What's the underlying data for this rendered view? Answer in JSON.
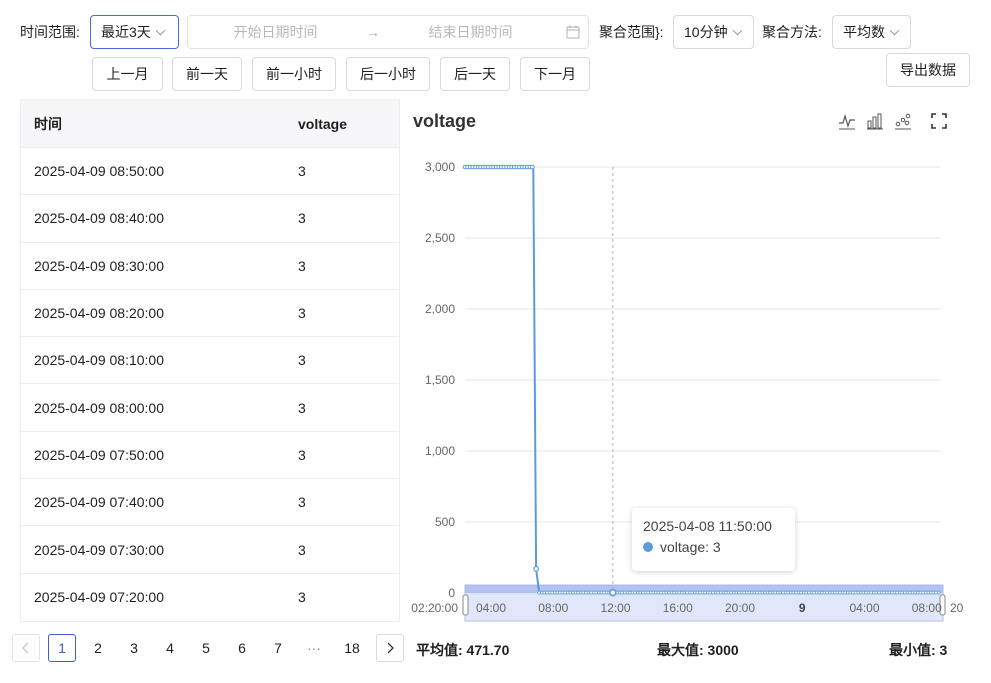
{
  "toolbar": {
    "time_range_label": "时间范围:",
    "time_range_value": "最近3天",
    "start_placeholder": "开始日期时间",
    "end_placeholder": "结束日期时间",
    "agg_range_label": "聚合范围}:",
    "agg_range_value": "10分钟",
    "agg_method_label": "聚合方法:",
    "agg_method_value": "平均数",
    "export_label": "导出数据",
    "nav_buttons": [
      "上一月",
      "前一天",
      "前一小时",
      "后一小时",
      "后一天",
      "下一月"
    ]
  },
  "table": {
    "headers": [
      "时间",
      "voltage"
    ],
    "rows": [
      [
        "2025-04-09 08:50:00",
        "3"
      ],
      [
        "2025-04-09 08:40:00",
        "3"
      ],
      [
        "2025-04-09 08:30:00",
        "3"
      ],
      [
        "2025-04-09 08:20:00",
        "3"
      ],
      [
        "2025-04-09 08:10:00",
        "3"
      ],
      [
        "2025-04-09 08:00:00",
        "3"
      ],
      [
        "2025-04-09 07:50:00",
        "3"
      ],
      [
        "2025-04-09 07:40:00",
        "3"
      ],
      [
        "2025-04-09 07:30:00",
        "3"
      ],
      [
        "2025-04-09 07:20:00",
        "3"
      ]
    ]
  },
  "pagination": {
    "pages": [
      "1",
      "2",
      "3",
      "4",
      "5",
      "6",
      "7",
      "···",
      "18"
    ],
    "current": "1"
  },
  "chart_title": "voltage",
  "tooltip": {
    "time": "2025-04-08 11:50:00",
    "series_label": "voltage: 3"
  },
  "stats": {
    "avg": "平均值:  471.70",
    "max": "最大值:  3000",
    "min": "最小值:  3"
  },
  "colors": {
    "accent": "#3d5fcf",
    "series": "#5b9bd8",
    "zoom_fill": "#c9d3f5"
  },
  "icons": [
    "line-chart-icon",
    "bar-chart-icon",
    "scatter-chart-icon",
    "fullscreen-icon",
    "calendar-icon",
    "chevron-down-icon",
    "arrow-right-icon"
  ],
  "chart_data": {
    "type": "line",
    "title": "voltage",
    "ylim": [
      0,
      3000
    ],
    "yticks": [
      "3,000",
      "2,500",
      "2,000",
      "1,500",
      "1,000",
      "500",
      "0"
    ],
    "x_start_label": "02:20:00",
    "x_end_label": "20",
    "xticks": [
      "04:00",
      "08:00",
      "12:00",
      "16:00",
      "20:00",
      "9",
      "04:00",
      "08:00"
    ],
    "x_hours": [
      4,
      8,
      12,
      16,
      20,
      24,
      28,
      32
    ],
    "x_range_hours": [
      2.33,
      32.85
    ],
    "series": [
      {
        "name": "voltage",
        "points": [
          [
            2.33,
            3000
          ],
          [
            6.72,
            3000
          ],
          [
            6.9,
            170
          ],
          [
            7.1,
            3
          ],
          [
            32.85,
            3
          ]
        ]
      }
    ],
    "tooltip_x_hours": 11.83,
    "grid": true
  }
}
